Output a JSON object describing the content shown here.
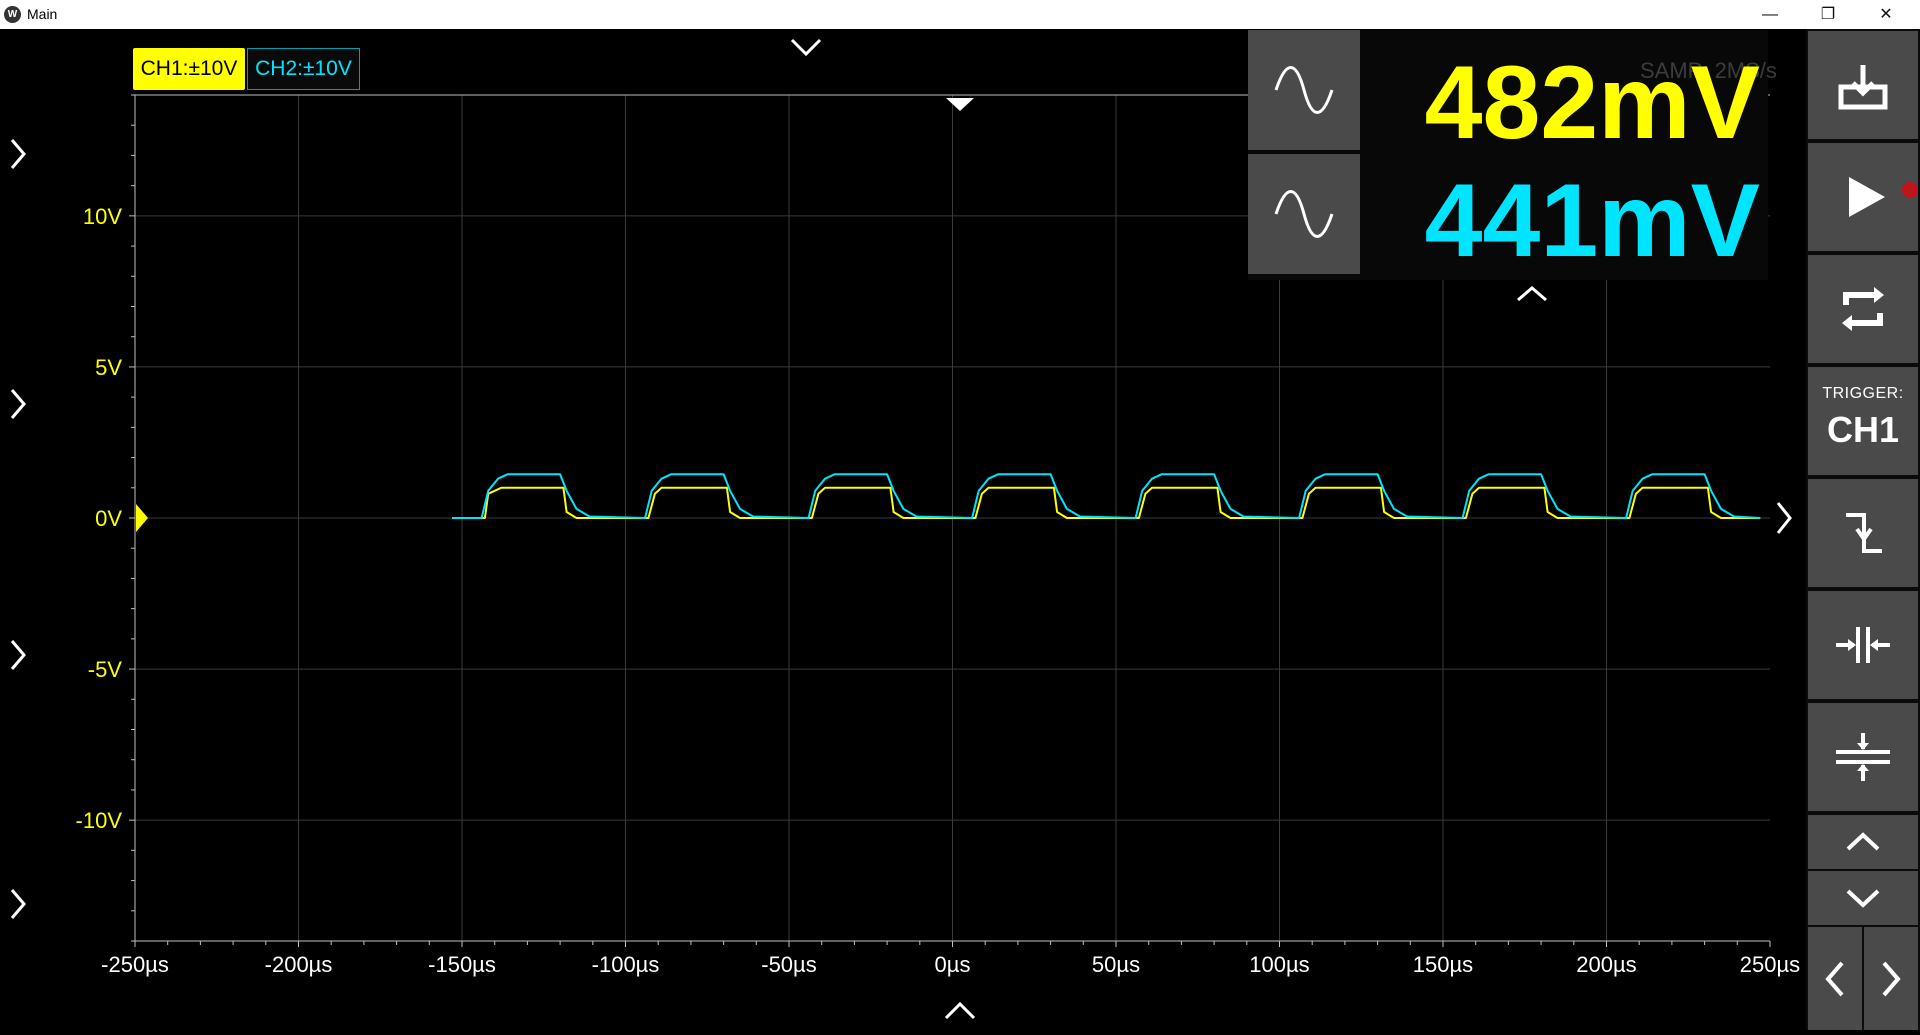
{
  "window": {
    "title": "Main",
    "icon": "app-logo-icon"
  },
  "channels": [
    {
      "label": "CH1:±10V",
      "color": "#ffff00"
    },
    {
      "label": "CH2:±10V",
      "color": "#00e5ff"
    }
  ],
  "measurements": [
    {
      "value": "482mV",
      "color": "#ffff00",
      "icon": "sine-wave-icon"
    },
    {
      "value": "441mV",
      "color": "#00e5ff",
      "icon": "sine-wave-icon"
    }
  ],
  "sample_rate_label": "SAMP: 2MS/s",
  "trigger": {
    "label": "TRIGGER:",
    "source": "CH1",
    "edge": "falling-edge-icon"
  },
  "toolbar_icons": [
    "save-icon",
    "play-icon",
    "auto-set-icon",
    "trigger-info",
    "falling-edge-icon",
    "time-scale-icon",
    "voltage-scale-icon",
    "scroll-up-icon",
    "scroll-down-icon",
    "prev-icon",
    "next-icon"
  ],
  "chart_data": {
    "type": "line",
    "xlim": [
      -250,
      250
    ],
    "ylim": [
      -14,
      14
    ],
    "x_ticks": [
      "-250µs",
      "-200µs",
      "-150µs",
      "-100µs",
      "-50µs",
      "0µs",
      "50µs",
      "100µs",
      "150µs",
      "200µs",
      "250µs"
    ],
    "y_ticks": [
      {
        "value": 10,
        "label": "10V"
      },
      {
        "value": 5,
        "label": "5V"
      },
      {
        "value": 0,
        "label": "0V"
      },
      {
        "value": -5,
        "label": "-5V"
      },
      {
        "value": -10,
        "label": "-10V"
      }
    ],
    "grid": true,
    "series": [
      {
        "name": "CH1",
        "color": "#ffff00",
        "x": [
          -153,
          -143,
          -142,
          -138,
          -119,
          -118,
          -115,
          -93,
          -91,
          -89,
          -69,
          -68,
          -65,
          -43,
          -41,
          -39,
          -19,
          -18,
          -15,
          7,
          9,
          11,
          31,
          32,
          35,
          57,
          59,
          61,
          81,
          82,
          85,
          107,
          109,
          111,
          131,
          132,
          135,
          157,
          159,
          161,
          181,
          182,
          185,
          207,
          209,
          211,
          231,
          232,
          235,
          247
        ],
        "y": [
          0.0,
          0.0,
          0.8,
          1.0,
          1.0,
          0.2,
          0.0,
          0.0,
          0.8,
          1.0,
          1.0,
          0.2,
          0.0,
          0.0,
          0.8,
          1.0,
          1.0,
          0.2,
          0.0,
          0.0,
          0.8,
          1.0,
          1.0,
          0.2,
          0.0,
          0.0,
          0.8,
          1.0,
          1.0,
          0.2,
          0.0,
          0.0,
          0.8,
          1.0,
          1.0,
          0.2,
          0.0,
          0.0,
          0.8,
          1.0,
          1.0,
          0.2,
          0.0,
          0.0,
          0.8,
          1.0,
          1.0,
          0.2,
          0.0,
          0.0
        ]
      },
      {
        "name": "CH2",
        "color": "#00e5ff",
        "x": [
          -153,
          -144,
          -142,
          -139,
          -136,
          -120,
          -118,
          -115,
          -111,
          -94,
          -92,
          -89,
          -86,
          -70,
          -68,
          -65,
          -61,
          -44,
          -42,
          -39,
          -36,
          -20,
          -18,
          -15,
          -11,
          6,
          8,
          11,
          14,
          30,
          32,
          35,
          39,
          56,
          58,
          61,
          64,
          80,
          82,
          85,
          89,
          106,
          108,
          111,
          114,
          130,
          132,
          135,
          139,
          156,
          158,
          161,
          164,
          180,
          182,
          185,
          189,
          206,
          208,
          211,
          214,
          230,
          232,
          235,
          239,
          247
        ],
        "y": [
          0.0,
          0.0,
          0.9,
          1.3,
          1.45,
          1.45,
          0.9,
          0.3,
          0.05,
          0.0,
          0.9,
          1.3,
          1.45,
          1.45,
          0.9,
          0.3,
          0.05,
          0.0,
          0.9,
          1.3,
          1.45,
          1.45,
          0.9,
          0.3,
          0.05,
          0.0,
          0.9,
          1.3,
          1.45,
          1.45,
          0.9,
          0.3,
          0.05,
          0.0,
          0.9,
          1.3,
          1.45,
          1.45,
          0.9,
          0.3,
          0.05,
          0.0,
          0.9,
          1.3,
          1.45,
          1.45,
          0.9,
          0.3,
          0.05,
          0.0,
          0.9,
          1.3,
          1.45,
          1.45,
          0.9,
          0.3,
          0.05,
          0.0,
          0.9,
          1.3,
          1.45,
          1.45,
          0.9,
          0.3,
          0.05,
          0.0
        ]
      }
    ]
  }
}
